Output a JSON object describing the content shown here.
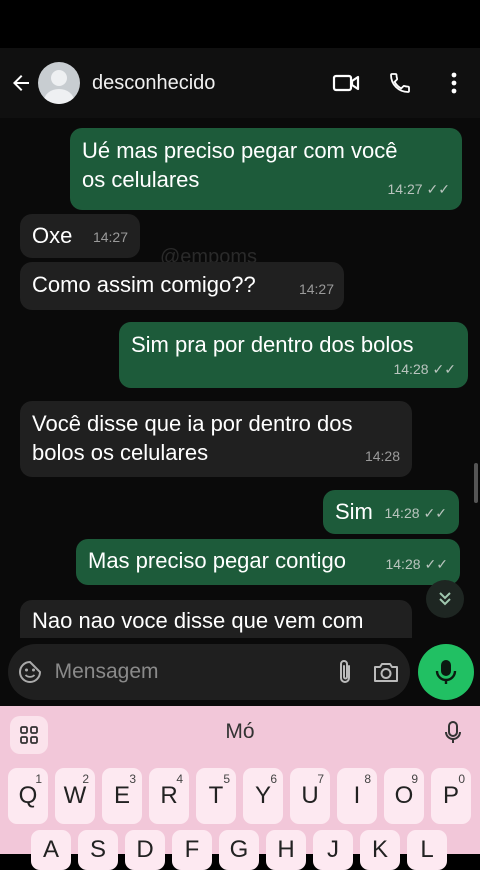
{
  "header": {
    "contact_name": "desconhecido",
    "icons": [
      "back-arrow-icon",
      "avatar",
      "video-call-icon",
      "phone-icon",
      "more-vert-icon"
    ]
  },
  "messages": [
    {
      "dir": "out",
      "lines": [
        "Ué mas preciso pegar com você",
        "os celulares"
      ],
      "time": "14:27",
      "ticks": "✓✓"
    },
    {
      "dir": "in",
      "lines": [
        "Oxe"
      ],
      "time": "14:27"
    },
    {
      "dir": "in",
      "lines": [
        "Como assim comigo??"
      ],
      "time": "14:27"
    },
    {
      "dir": "out",
      "lines": [
        "Sim pra por dentro dos bolos"
      ],
      "time": "14:28",
      "ticks": "✓✓"
    },
    {
      "dir": "in",
      "lines": [
        "Você disse que ia por dentro dos",
        "bolos os celulares"
      ],
      "time": "14:28"
    },
    {
      "dir": "out",
      "lines": [
        "Sim"
      ],
      "time": "14:28",
      "ticks": "✓✓"
    },
    {
      "dir": "out",
      "lines": [
        "Mas preciso pegar contigo"
      ],
      "time": "14:28",
      "ticks": "✓✓"
    },
    {
      "dir": "in",
      "lines": [
        "Nao nao voce disse que vem com"
      ],
      "time": ""
    }
  ],
  "watermark": "@empoms",
  "composer": {
    "placeholder": "Mensagem"
  },
  "keyboard": {
    "suggestion": "Mó",
    "row1": [
      {
        "key": "Q",
        "num": "1"
      },
      {
        "key": "W",
        "num": "2"
      },
      {
        "key": "E",
        "num": "3"
      },
      {
        "key": "R",
        "num": "4"
      },
      {
        "key": "T",
        "num": "5"
      },
      {
        "key": "Y",
        "num": "6"
      },
      {
        "key": "U",
        "num": "7"
      },
      {
        "key": "I",
        "num": "8"
      },
      {
        "key": "O",
        "num": "9"
      },
      {
        "key": "P",
        "num": "0"
      }
    ],
    "row2": [
      "A",
      "S",
      "D",
      "F",
      "G",
      "H",
      "J",
      "K",
      "L"
    ]
  },
  "colors": {
    "outgoing": "#1d5b3a",
    "incoming": "#202020",
    "accent": "#21c063",
    "keyboard": "#f2c7d9"
  }
}
